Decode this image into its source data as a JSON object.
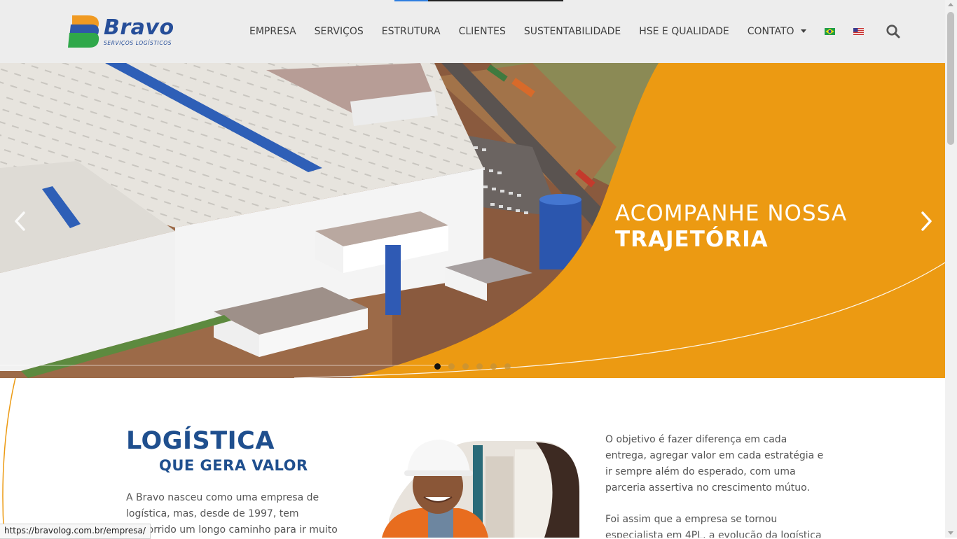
{
  "brand": {
    "name": "Bravo",
    "tagline": "SERVIÇOS LOGÍSTICOS",
    "logo_colors": [
      "#f09a22",
      "#2f58a8",
      "#2fa84a"
    ]
  },
  "nav": {
    "items": [
      {
        "label": "EMPRESA"
      },
      {
        "label": "SERVIÇOS"
      },
      {
        "label": "ESTRUTURA"
      },
      {
        "label": "CLIENTES"
      },
      {
        "label": "SUSTENTABILIDADE"
      },
      {
        "label": "HSE E QUALIDADE"
      },
      {
        "label": "CONTATO",
        "has_dropdown": true
      }
    ],
    "languages": [
      {
        "code": "pt-BR",
        "icon": "brazil-flag-icon"
      },
      {
        "code": "en-US",
        "icon": "usa-flag-icon"
      }
    ],
    "search_icon": "search-icon"
  },
  "hero": {
    "title_line1": "ACOMPANHE NOSSA",
    "title_line2": "TRAJETÓRIA",
    "slide_count": 6,
    "active_slide": 1,
    "accent_color": "#ec9a12",
    "prev_icon": "chevron-left-icon",
    "next_icon": "chevron-right-icon"
  },
  "section": {
    "title": "LOGÍSTICA",
    "subtitle": "QUE GERA VALOR",
    "intro": "A Bravo nasceu como uma empresa de logística, mas, desde de 1997, tem percorrido um longo caminho para ir muito além disso",
    "right_paragraphs": [
      "O objetivo é fazer diferença em cada entrega, agregar valor em cada estratégia e ir sempre além do esperado, com uma parceria assertiva no crescimento mútuo.",
      "Foi assim que a empresa se tornou especialista em 4PL, a evolução da logística"
    ],
    "title_color": "#1f4f8e"
  },
  "status_bar": {
    "url": "https://bravolog.com.br/empresa/"
  }
}
